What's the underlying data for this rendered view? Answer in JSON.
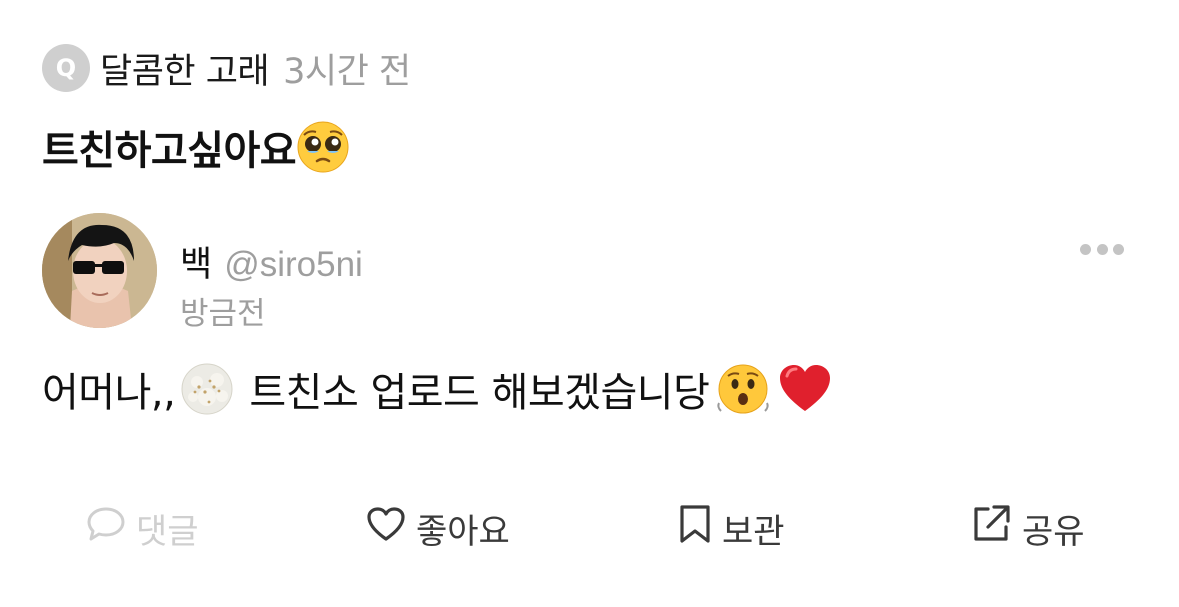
{
  "question": {
    "badge": "Q",
    "asker": "달콤한 고래",
    "time": "3시간 전",
    "text": "트친하고싶아요",
    "emoji": "pleading-face"
  },
  "answer": {
    "name": "백",
    "handle": "@siro5ni",
    "time": "방금전",
    "text_part1": "어머나,,",
    "text_part2": "트친소 업로드 해보겠습니당",
    "emojis": [
      "face-exhaling",
      "hushed-face",
      "red-heart"
    ]
  },
  "actions": {
    "comment": "댓글",
    "like": "좋아요",
    "save": "보관",
    "share": "공유"
  },
  "colors": {
    "muted": "#9e9e9e",
    "badge": "#cfcfcf",
    "disabled": "#cfcfcf",
    "heart": "#e0202d"
  }
}
